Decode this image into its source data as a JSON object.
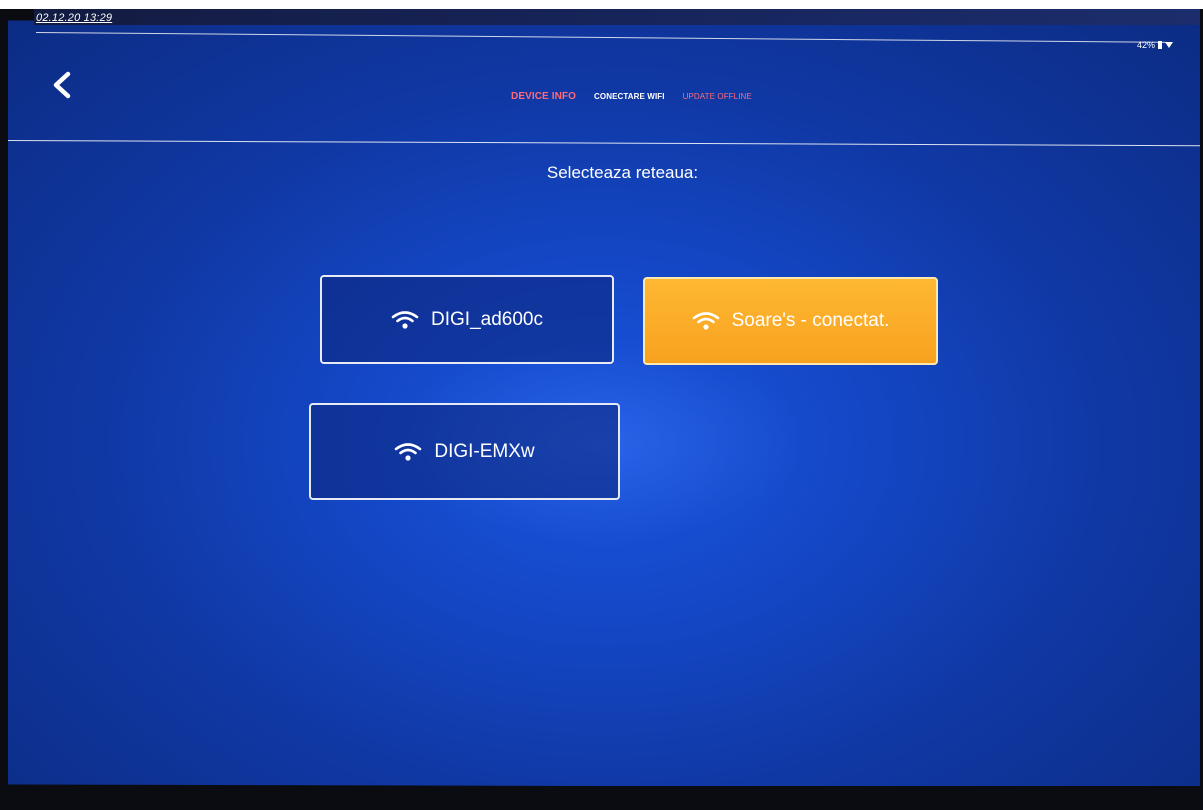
{
  "status_bar": {
    "datetime": "02.12.20 13:29",
    "battery": "42%"
  },
  "nav": {
    "back_icon": "chevron-left-icon",
    "tabs": [
      {
        "label": "DEVICE INFO",
        "color": "#ff6a78"
      },
      {
        "label": "CONECTARE WIFI",
        "color": "#ffffff"
      },
      {
        "label": "UPDATE OFFLINE",
        "color": "#ff6a78"
      }
    ]
  },
  "main": {
    "title": "Selecteaza reteaua:",
    "networks": [
      {
        "label": "DIGI_ad600c",
        "active": false
      },
      {
        "label": "Soare's - conectat.",
        "active": true
      },
      {
        "label": "DIGI-EMXw",
        "active": false
      }
    ]
  },
  "colors": {
    "background": "#1447c6",
    "active_network": "#f7a21f",
    "tab_accent": "#ff6a78"
  }
}
